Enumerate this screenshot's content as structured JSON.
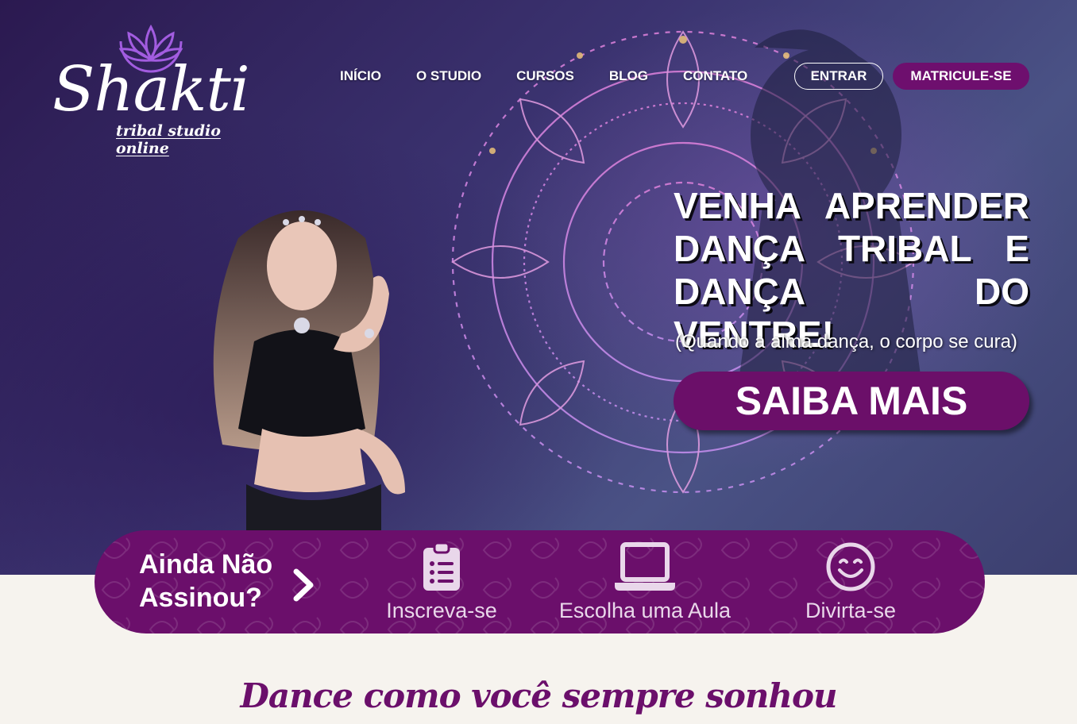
{
  "brand": {
    "name": "Shakti",
    "subtitle": "tribal studio online"
  },
  "nav": {
    "items": [
      "INÍCIO",
      "O STUDIO",
      "CURSOS",
      "BLOG",
      "CONTATO"
    ],
    "login_label": "ENTRAR",
    "signup_label": "MATRICULE-SE"
  },
  "hero": {
    "headline_lines": [
      "VENHA APRENDER",
      "DANÇA TRIBAL E",
      "DANÇA DO VENTRE!"
    ],
    "subheadline": "(Quando a alma dança, o corpo se cura)",
    "cta_label": "SAIBA MAIS"
  },
  "steps": {
    "title_lines": [
      "Ainda Não",
      "Assinou?"
    ],
    "items": [
      {
        "icon": "clipboard-list-icon",
        "label": "Inscreva-se"
      },
      {
        "icon": "laptop-icon",
        "label": "Escolha uma Aula"
      },
      {
        "icon": "smile-icon",
        "label": "Divirta-se"
      }
    ]
  },
  "tagline": "Dance como você sempre sonhou",
  "colors": {
    "brand_purple": "#6b0f6b",
    "hero_background": "#3b3370",
    "page_background": "#f6f3ee"
  }
}
